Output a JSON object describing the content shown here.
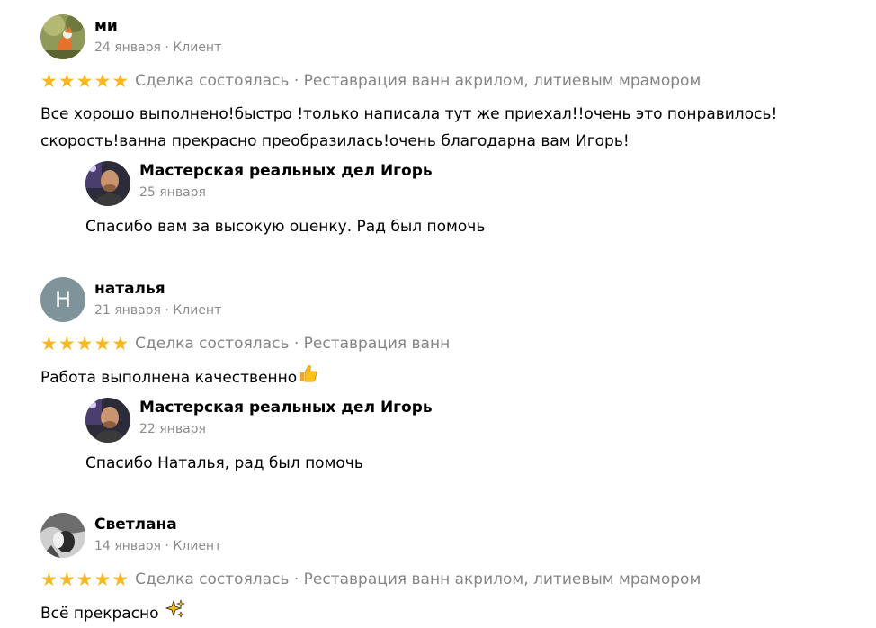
{
  "reviews": [
    {
      "author": "ми",
      "meta": "24 января · Клиент",
      "stars": 5,
      "deal": "Сделка состоялась · Реставрация ванн акрилом, литиевым мрамором",
      "text_line1": "Все хорошо выполнено!быстро !только написала тут же приехал!!очень это понравилось!",
      "text_line2": "скорость!ванна прекрасно преобразилась!очень благодарна вам Игорь!",
      "reply": {
        "author": "Мастерская реальных дел Игорь",
        "date": "25 января",
        "text": "Спасибо вам за высокую оценку. Рад был помочь"
      }
    },
    {
      "author": "наталья",
      "avatar_letter": "Н",
      "meta": "21 января · Клиент",
      "stars": 5,
      "deal": "Сделка состоялась · Реставрация ванн",
      "text": "Работа выполнена качественно",
      "text_emoji": "thumbs-up-icon",
      "reply": {
        "author": "Мастерская реальных дел Игорь",
        "date": "22 января",
        "text": "Спасибо Наталья, рад был помочь"
      }
    },
    {
      "author": "Светлана",
      "meta": "14 января · Клиент",
      "stars": 5,
      "deal": "Сделка состоялась · Реставрация ванн акрилом, литиевым мрамором",
      "text": "Всё прекрасно",
      "text_emoji": "sparkles-icon"
    }
  ],
  "colors": {
    "star": "#f9b820",
    "meta_text": "#8c8c8c",
    "deal_text": "#858585",
    "letter_avatar_bg": "#7f949a"
  }
}
